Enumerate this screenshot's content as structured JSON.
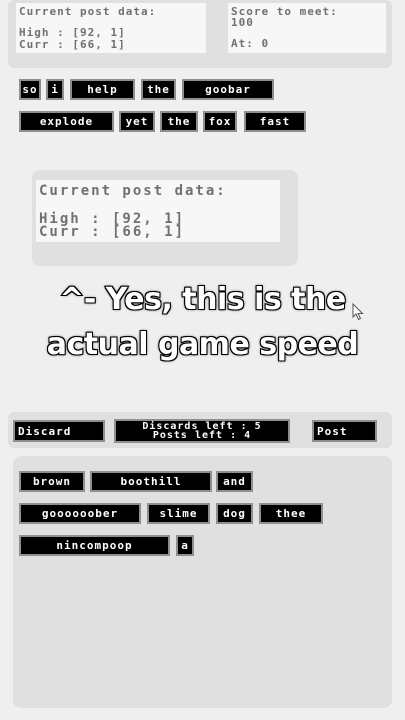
{
  "top_panel": {
    "post_heading": "Current post data:",
    "high_line": "High : [92, 1]",
    "curr_line": "Curr : [66, 1]",
    "score_heading_1": "Score to meet:",
    "score_value": "100",
    "at_line": "At: 0"
  },
  "post_words_row1": [
    "so",
    "i",
    "help",
    "the",
    "goobar"
  ],
  "post_words_row2": [
    "explode",
    "yet",
    "the",
    "fox",
    "fast"
  ],
  "mid_panel": {
    "heading": "Current post data:",
    "high_line": "High : [92, 1]",
    "curr_line": "Curr : [66, 1]"
  },
  "caption": {
    "line1": "^- Yes, this is the",
    "line2": "actual game speed"
  },
  "controls": {
    "discard_label": "Discard",
    "discards_left": "Discards left : 5",
    "posts_left": "Posts left : 4",
    "post_label": "Post"
  },
  "hand_row1": [
    "brown",
    "boothill",
    "and"
  ],
  "hand_row2": [
    "goooooober",
    "slime",
    "dog",
    "thee"
  ],
  "hand_row3": [
    "nincompoop",
    "a"
  ],
  "colors": {
    "background": "#efefef",
    "panel": "#e0e0e0",
    "tile": "#000000",
    "tile_border": "#8f8f8f",
    "text": "#707070"
  }
}
